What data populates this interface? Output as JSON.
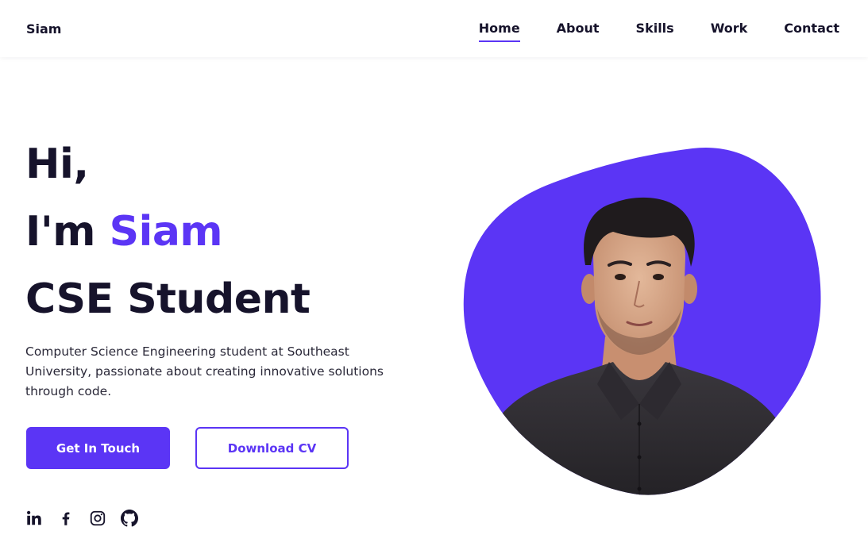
{
  "header": {
    "logo": "Siam",
    "nav": [
      {
        "label": "Home",
        "active": true
      },
      {
        "label": "About",
        "active": false
      },
      {
        "label": "Skills",
        "active": false
      },
      {
        "label": "Work",
        "active": false
      },
      {
        "label": "Contact",
        "active": false
      }
    ]
  },
  "hero": {
    "greeting": "Hi,",
    "intro_prefix": "I'm",
    "name": "Siam",
    "role": "CSE Student",
    "description": "Computer Science Engineering student at Southeast University, passionate about creating innovative solutions through code.",
    "primary_button": "Get In Touch",
    "secondary_button": "Download CV"
  },
  "socials": [
    {
      "icon": "linkedin-icon"
    },
    {
      "icon": "facebook-icon"
    },
    {
      "icon": "instagram-icon"
    },
    {
      "icon": "github-icon"
    }
  ],
  "colors": {
    "accent": "#5b35f5",
    "text": "#16132b",
    "background": "#ffffff"
  }
}
